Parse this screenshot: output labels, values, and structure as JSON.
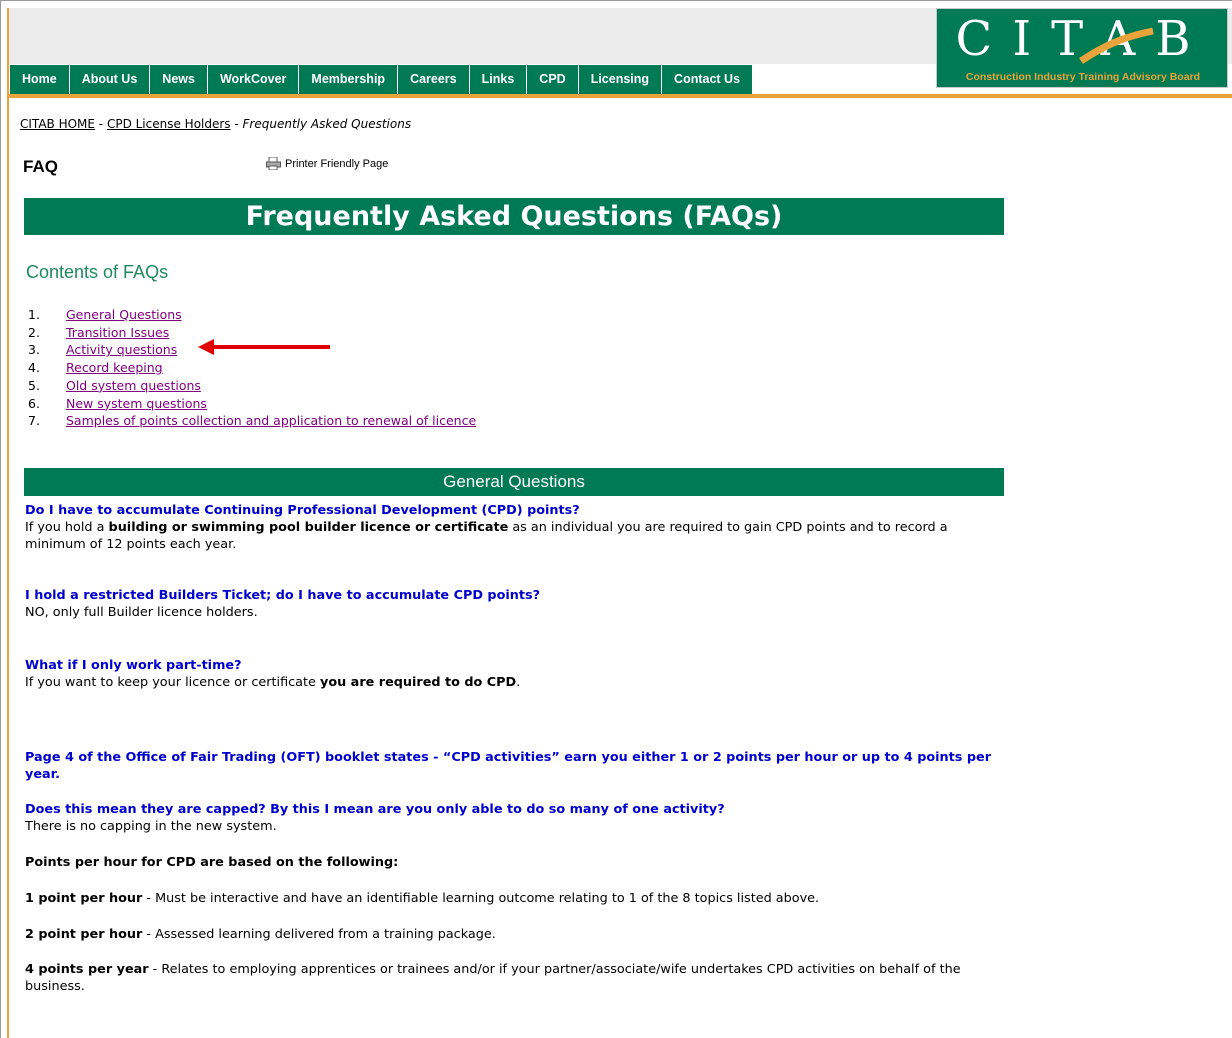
{
  "header": {
    "nav": [
      "Home",
      "About Us",
      "News",
      "WorkCover",
      "Membership",
      "Careers",
      "Links",
      "CPD",
      "Licensing",
      "Contact Us"
    ],
    "logo_word": "CITAB",
    "logo_tagline": "Construction Industry Training Advisory Board"
  },
  "breadcrumb": {
    "home": "CITAB HOME",
    "sep1": " - ",
    "section": "CPD License Holders",
    "sep2": " - ",
    "current": "Frequently Asked Questions"
  },
  "faq_heading": "FAQ",
  "printer_label": "Printer Friendly Page",
  "main_title": "Frequently Asked Questions (FAQs)",
  "contents_title": "Contents of FAQs",
  "toc": [
    {
      "num": "1.",
      "label": "General Questions"
    },
    {
      "num": "2.",
      "label": "Transition Issues"
    },
    {
      "num": "3.",
      "label": "Activity questions"
    },
    {
      "num": "4.",
      "label": "Record keeping"
    },
    {
      "num": "5.",
      "label": "Old system questions"
    },
    {
      "num": "6.",
      "label": "New system questions"
    },
    {
      "num": "7.",
      "label": "Samples of points collection and application to renewal of licence"
    }
  ],
  "section_title": "General Questions",
  "faqs": {
    "q1": "Do I have to accumulate Continuing Professional Development (CPD) points?",
    "a1_pre": "If you hold a ",
    "a1_bold": "building or swimming pool builder licence or certificate",
    "a1_post": " as an individual you are required to gain CPD points and to record a minimum of 12 points each year.",
    "q2": "I hold a restricted Builders Ticket; do I have to accumulate CPD points?",
    "a2": "NO, only full Builder licence holders.",
    "q3": "What if I only work part-time?",
    "a3_pre": "If you want to keep your licence or certificate ",
    "a3_bold": "you are required to do CPD",
    "a3_post": ".",
    "q4": "Page 4 of the Office of Fair Trading (OFT) booklet states - “CPD activities” earn you either 1 or 2 points per hour or up to 4 points per year.",
    "q5": "Does this mean they are capped? By this I mean are you only able to do so many of one activity?",
    "a5": "There is no capping in the new system.",
    "points_heading": "Points per hour for CPD are based on the following:",
    "p1_bold": "1 point per hour",
    "p1_text": " - Must be interactive and have an identifiable learning outcome relating to 1 of the 8 topics listed above.",
    "p2_bold": "2 point per hour",
    "p2_text": " - Assessed learning delivered from a training package.",
    "p4_bold": "4 points per year",
    "p4_text": " - Relates to employing apprentices or trainees and/or if your partner/associate/wife undertakes CPD activities on behalf of the business."
  },
  "colors": {
    "brand_green": "#007a53",
    "accent_orange": "#e8a33a",
    "question_blue": "#0000cc",
    "link_visited": "#800080",
    "arrow_red": "#e00000"
  }
}
